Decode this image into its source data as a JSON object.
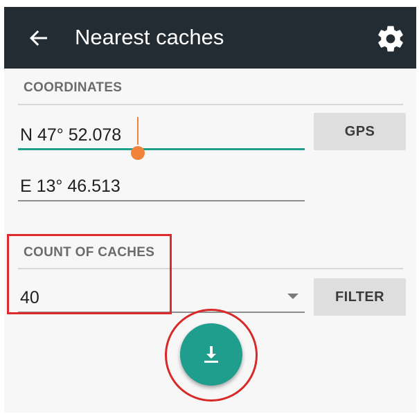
{
  "toolbar": {
    "back_icon": "arrow-left-icon",
    "title": "Nearest caches",
    "settings_icon": "gear-icon",
    "background": "#232b33"
  },
  "coordinates": {
    "section_label": "COORDINATES",
    "latitude_value": "N 47° 52.078",
    "longitude_value": "E 13° 46.513",
    "gps_button_label": "GPS"
  },
  "count": {
    "section_label": "COUNT OF CACHES",
    "selected_value": "40",
    "filter_button_label": "FILTER"
  },
  "fab": {
    "icon": "download-icon",
    "color": "#1f9d8d"
  },
  "colors": {
    "accent": "#1f9d8d",
    "cursor": "#f0823a",
    "highlight": "#e02a2a"
  }
}
